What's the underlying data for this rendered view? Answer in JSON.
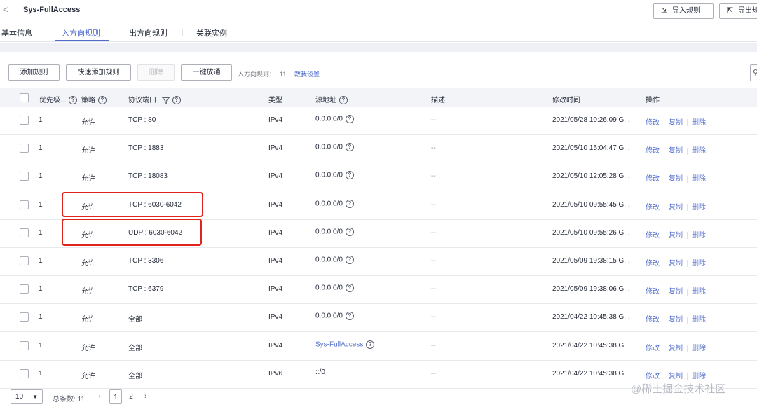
{
  "header": {
    "back_glyph": "<",
    "title": "Sys-FullAccess",
    "import_label": "导入规则",
    "export_label": "导出规"
  },
  "tabs": [
    {
      "label": "基本信息"
    },
    {
      "label": "入方向规则",
      "active": true
    },
    {
      "label": "出方向规则"
    },
    {
      "label": "关联实例"
    }
  ],
  "toolbar": {
    "add_label": "添加规则",
    "quick_add_label": "快速添加规则",
    "delete_label": "删除",
    "open_all_label": "一键放通",
    "info_label": "入方向规则：",
    "info_count": "11",
    "help_link": "教我设置"
  },
  "table": {
    "columns": [
      "优先级...",
      "策略",
      "协议端口",
      "类型",
      "源地址",
      "描述",
      "修改时间",
      "操作"
    ],
    "ops": [
      "修改",
      "复制",
      "删除"
    ],
    "rows": [
      {
        "priority": "1",
        "policy": "允许",
        "port": "TCP : 80",
        "type": "IPv4",
        "source": "0.0.0.0/0",
        "source_help": true,
        "desc": "--",
        "time": "2021/05/28 10:26:09 G..."
      },
      {
        "priority": "1",
        "policy": "允许",
        "port": "TCP : 1883",
        "type": "IPv4",
        "source": "0.0.0.0/0",
        "source_help": true,
        "desc": "--",
        "time": "2021/05/10 15:04:47 G..."
      },
      {
        "priority": "1",
        "policy": "允许",
        "port": "TCP : 18083",
        "type": "IPv4",
        "source": "0.0.0.0/0",
        "source_help": true,
        "desc": "--",
        "time": "2021/05/10 12:05:28 G..."
      },
      {
        "priority": "1",
        "policy": "允许",
        "port": "TCP : 6030-6042",
        "type": "IPv4",
        "source": "0.0.0.0/0",
        "source_help": true,
        "desc": "--",
        "time": "2021/05/10 09:55:45 G..."
      },
      {
        "priority": "1",
        "policy": "允许",
        "port": "UDP : 6030-6042",
        "type": "IPv4",
        "source": "0.0.0.0/0",
        "source_help": true,
        "desc": "--",
        "time": "2021/05/10 09:55:26 G..."
      },
      {
        "priority": "1",
        "policy": "允许",
        "port": "TCP : 3306",
        "type": "IPv4",
        "source": "0.0.0.0/0",
        "source_help": true,
        "desc": "--",
        "time": "2021/05/09 19:38:15 G..."
      },
      {
        "priority": "1",
        "policy": "允许",
        "port": "TCP : 6379",
        "type": "IPv4",
        "source": "0.0.0.0/0",
        "source_help": true,
        "desc": "--",
        "time": "2021/05/09 19:38:06 G..."
      },
      {
        "priority": "1",
        "policy": "允许",
        "port": "全部",
        "type": "IPv4",
        "source": "0.0.0.0/0",
        "source_help": true,
        "desc": "--",
        "time": "2021/04/22 10:45:38 G..."
      },
      {
        "priority": "1",
        "policy": "允许",
        "port": "全部",
        "type": "IPv4",
        "source": "Sys-FullAccess",
        "source_help": true,
        "source_link": true,
        "desc": "--",
        "time": "2021/04/22 10:45:38 G..."
      },
      {
        "priority": "1",
        "policy": "允许",
        "port": "全部",
        "type": "IPv6",
        "source": "::/0",
        "source_help": false,
        "desc": "--",
        "time": "2021/04/22 10:45:38 G..."
      }
    ]
  },
  "pagination": {
    "page_size": "10",
    "total_label": "总条数: 11",
    "pages": [
      "1",
      "2"
    ],
    "current_page": "1"
  },
  "watermark": "@稀土掘金技术社区",
  "colors": {
    "accent": "#526ecc",
    "highlight": "#e0231c"
  }
}
